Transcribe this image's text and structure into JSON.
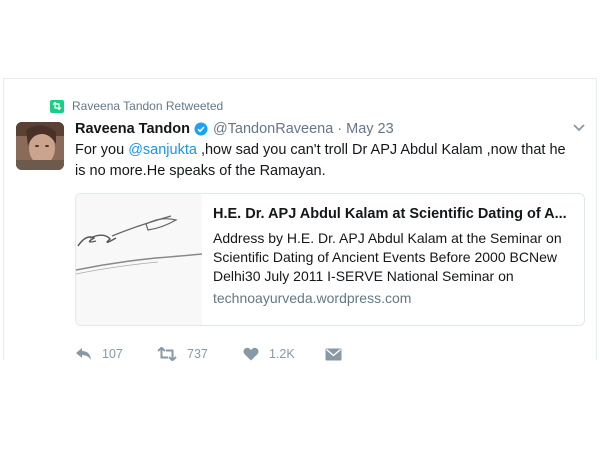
{
  "retweet_context": {
    "label": "Raveena Tandon Retweeted",
    "icon": "retweet-icon"
  },
  "tweet": {
    "author_name": "Raveena Tandon",
    "handle": "@TandonRaveena",
    "separator": "·",
    "time": "May 23",
    "text_before_mention": "For you ",
    "mention": "@sanjukta",
    "text_after_mention": " ,how sad you can't troll Dr APJ Abdul Kalam ,now that he is no more.He speaks of the Ramayan.",
    "verified": true
  },
  "link_card": {
    "title": "H.E. Dr. APJ Abdul Kalam at Scientific Dating of A...",
    "description": "Address by H.E. Dr. APJ Abdul Kalam at the Seminar on Scientific Dating of Ancient Events Before 2000 BCNew Delhi30 July 2011  I-SERVE National Seminar on",
    "domain": "technoayurveda.wordpress.com"
  },
  "actions": {
    "reply_count": "107",
    "retweet_count": "737",
    "like_count": "1.2K"
  },
  "colors": {
    "link_blue": "#1b95e0",
    "retweet_green": "#19cf86",
    "muted_gray": "#657786",
    "action_gray": "#8899a6"
  }
}
